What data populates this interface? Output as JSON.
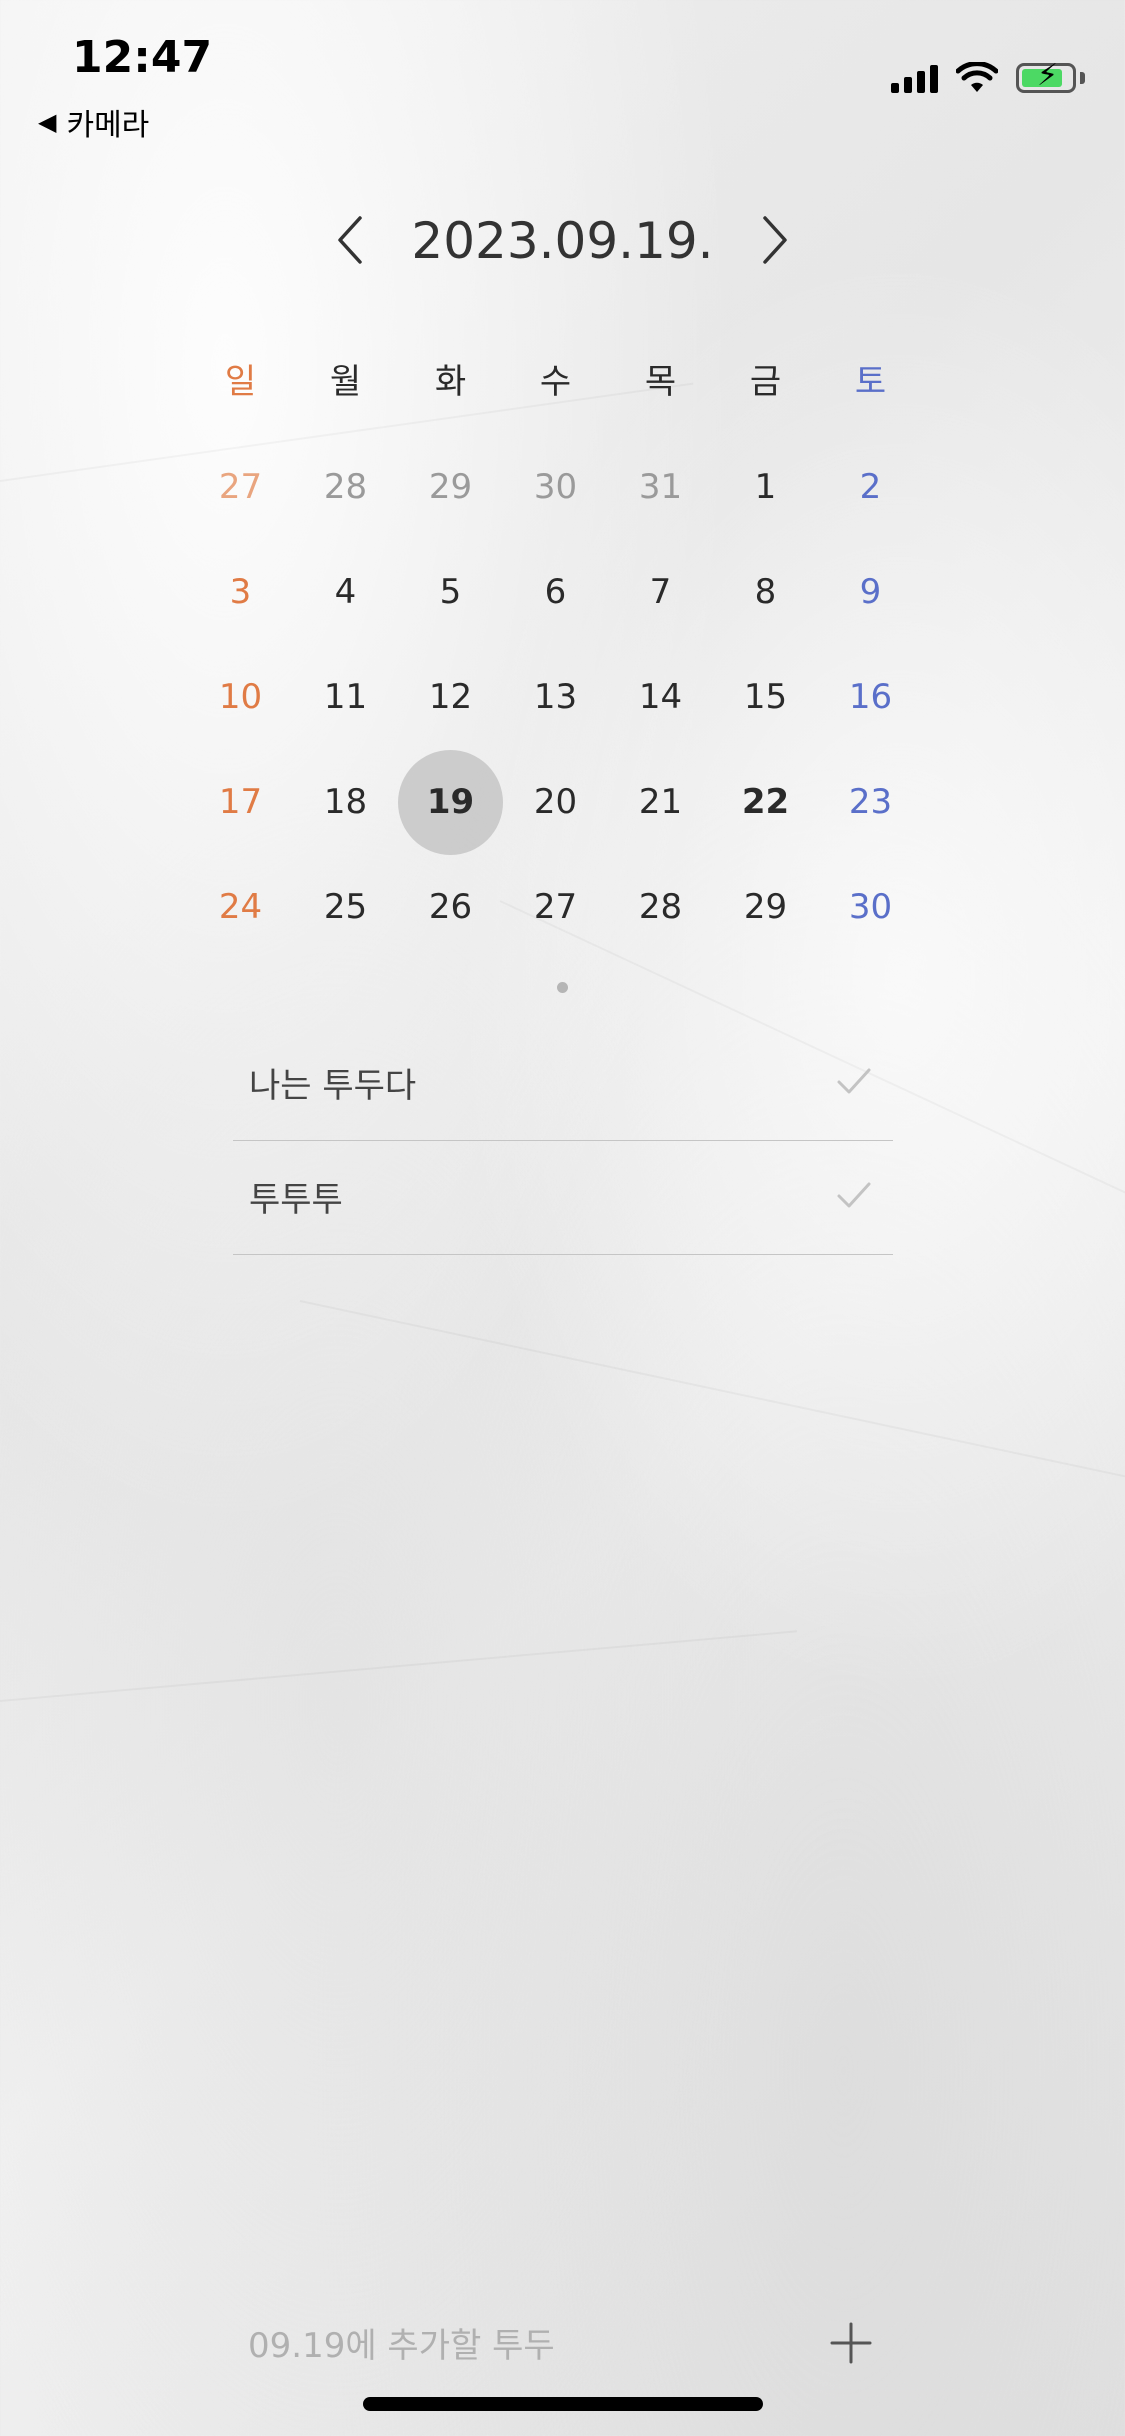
{
  "status": {
    "time": "12:47",
    "back_label": "카메라",
    "signal_icon": "signal-icon",
    "wifi_icon": "wifi-icon",
    "battery_icon": "battery-charging-icon"
  },
  "header": {
    "date": "2023.09.19.",
    "prev_icon": "chevron-left-icon",
    "next_icon": "chevron-right-icon"
  },
  "calendar": {
    "weekdays": [
      "일",
      "월",
      "화",
      "수",
      "목",
      "금",
      "토"
    ],
    "weeks": [
      [
        "27",
        "28",
        "29",
        "30",
        "31",
        "1",
        "2"
      ],
      [
        "3",
        "4",
        "5",
        "6",
        "7",
        "8",
        "9"
      ],
      [
        "10",
        "11",
        "12",
        "13",
        "14",
        "15",
        "16"
      ],
      [
        "17",
        "18",
        "19",
        "20",
        "21",
        "22",
        "23"
      ],
      [
        "24",
        "25",
        "26",
        "27",
        "28",
        "29",
        "30"
      ]
    ],
    "selected": "19",
    "today": "22"
  },
  "todos": [
    {
      "text": "나는 투두다",
      "icon": "check-icon"
    },
    {
      "text": "투투투",
      "icon": "check-icon"
    }
  ],
  "add": {
    "placeholder": "09.19에 추가할 투두",
    "icon": "plus-icon"
  },
  "colors": {
    "sunday": "#e07b45",
    "saturday": "#5a6fc9",
    "selected_bg": "#c4c4c4"
  }
}
